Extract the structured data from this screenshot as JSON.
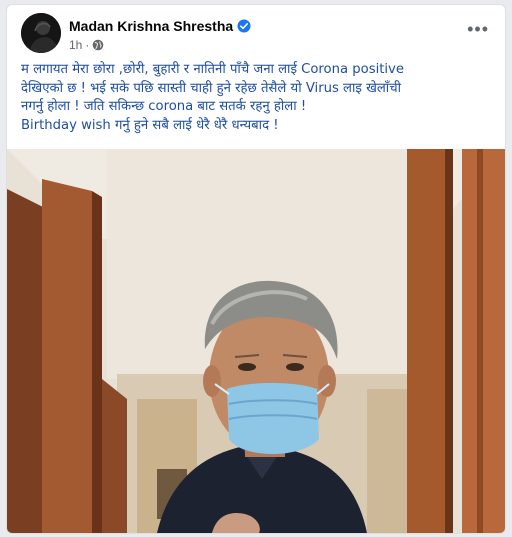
{
  "post": {
    "author": "Madan Krishna Shrestha",
    "time": "1h",
    "dot": "·",
    "more": "•••",
    "lines": [
      "म लगायत मेरा छोरा ,छोरी, बुहारी र नातिनी पाँचै जना लाई Corona positive",
      "देखिएको छ ! भई सके पछि सास्ती चाही हुने रहेछ तेसैले यो Virus लाइ खेलाँची",
      "नगर्नु होला ! जति सकिन्छ corona बाट सतर्क रहनु होला !",
      "Birthday wish गर्नु हुने सबै लाई धेरै धेरै धन्यबाद !"
    ]
  },
  "icons": {
    "verified": "verified-badge-icon",
    "privacy": "globe-icon",
    "more": "more-options-icon"
  },
  "colors": {
    "verified": "#1877f2",
    "text": "#1f4ea0",
    "mask": "#8ec6e6"
  }
}
